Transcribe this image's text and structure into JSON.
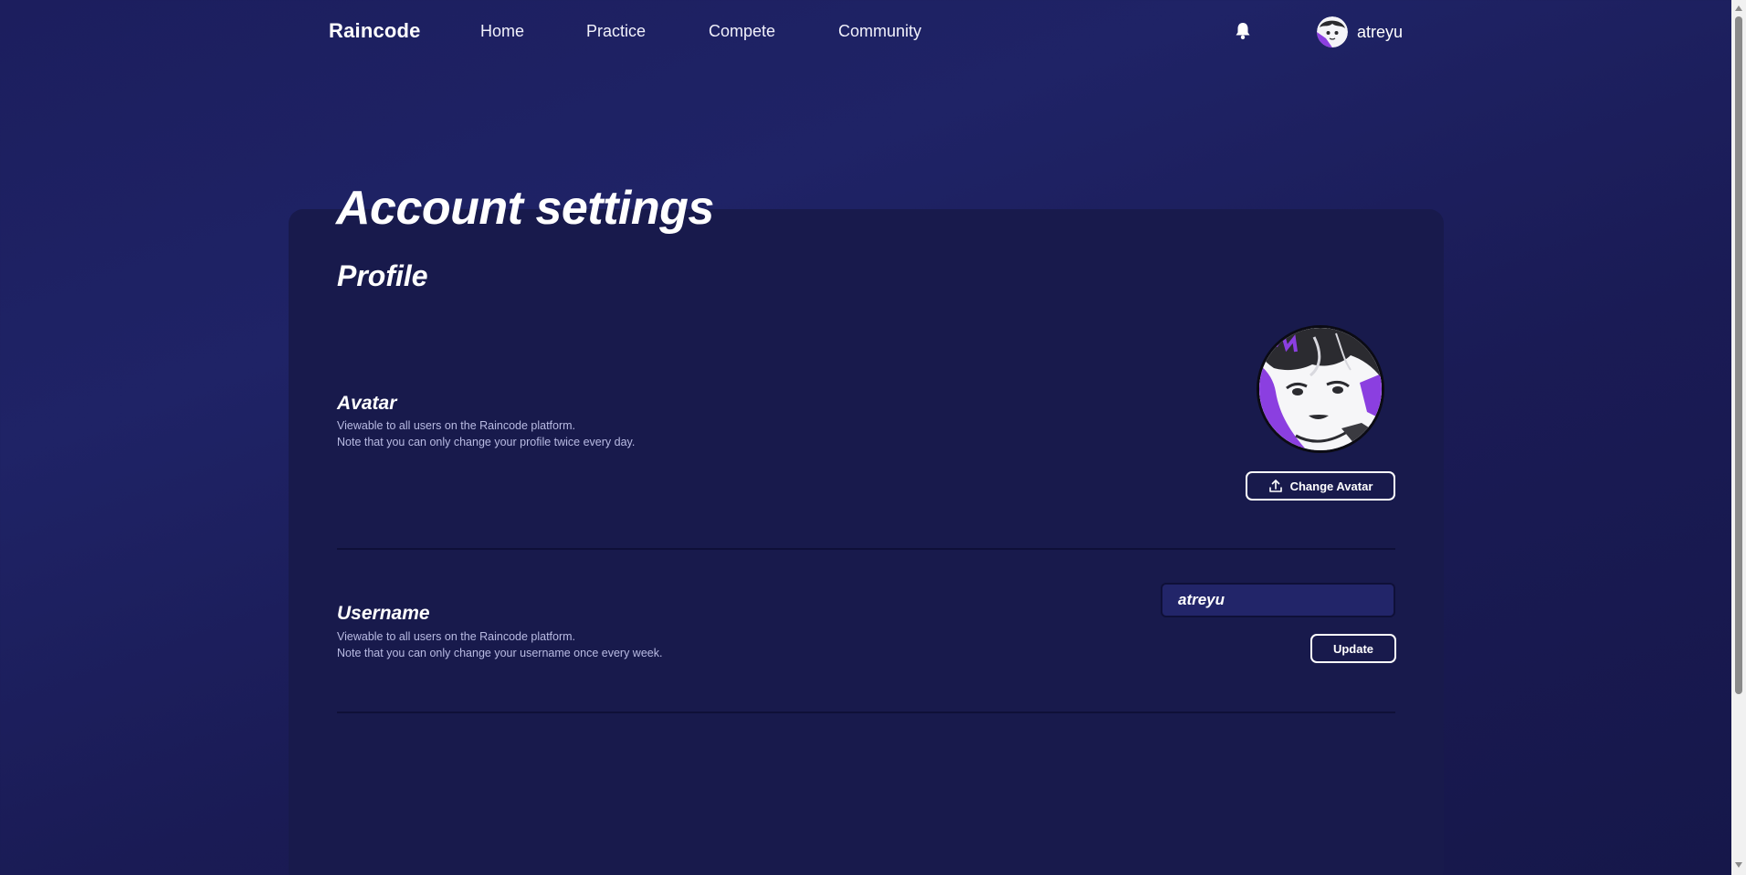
{
  "nav": {
    "brand": "Raincode",
    "links": [
      "Home",
      "Practice",
      "Compete",
      "Community"
    ],
    "username": "atreyu"
  },
  "page": {
    "title": "Account settings",
    "section_title": "Profile"
  },
  "avatar_row": {
    "title": "Avatar",
    "desc_line1": "Viewable to all users on the Raincode platform.",
    "desc_line2": "Note that you can only change your profile twice every day.",
    "button_label": "Change Avatar"
  },
  "username_row": {
    "title": "Username",
    "desc_line1": "Viewable to all users on the Raincode platform.",
    "desc_line2": "Note that you can only change your username once every week.",
    "input_value": "atreyu",
    "button_label": "Update"
  },
  "colors": {
    "background": "#1c1e5e",
    "card": "#181a4c",
    "accent_purple": "#8b3fe0",
    "text": "#ffffff",
    "muted_text": "#b9bbe3"
  }
}
